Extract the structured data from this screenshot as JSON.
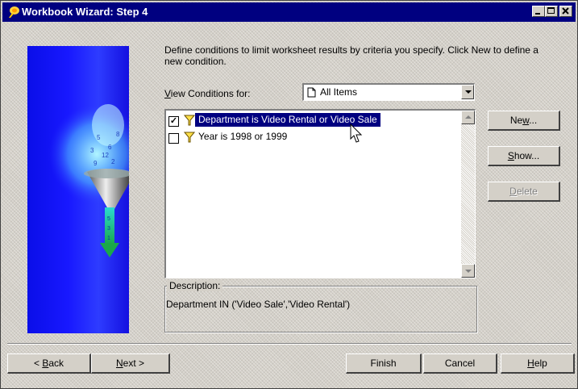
{
  "window": {
    "title": "Workbook Wizard: Step 4",
    "controls": {
      "minimize": "_",
      "maximize": "□",
      "close": "×"
    }
  },
  "intro_text": "Define conditions to limit worksheet results by criteria you specify. Click New to define a new condition.",
  "view_conditions": {
    "label": "View Conditions for:",
    "accel_char": "V",
    "label_rest": "iew Conditions for:",
    "selected": "All Items"
  },
  "conditions": [
    {
      "label": "Department is Video Rental or Video Sale",
      "checked": true,
      "selected": true
    },
    {
      "label": "Year is 1998 or 1999",
      "checked": false,
      "selected": false
    }
  ],
  "description": {
    "label": "Description:",
    "text": "Department IN ('Video Sale','Video Rental')"
  },
  "side_buttons": {
    "new": {
      "pre": "Ne",
      "accel": "w",
      "post": "...",
      "label": "New..."
    },
    "show": {
      "pre": "",
      "accel": "S",
      "post": "how...",
      "label": "Show..."
    },
    "delete": {
      "pre": "",
      "accel": "D",
      "post": "elete",
      "label": "Delete",
      "enabled": false
    }
  },
  "bottom_buttons": {
    "back": {
      "pre": "< ",
      "accel": "B",
      "post": "ack",
      "label": "< Back"
    },
    "next": {
      "pre": "",
      "accel": "N",
      "post": "ext >",
      "label": "Next >"
    },
    "finish": "Finish",
    "cancel": "Cancel",
    "help": {
      "pre": "",
      "accel": "H",
      "post": "elp",
      "label": "Help"
    }
  },
  "colors": {
    "titlebar": "#000080",
    "selection": "#000080",
    "dialog_bg": "#d4d0c8",
    "side_image_blue": "#1818ff"
  },
  "icons": {
    "title": "wizard-icon",
    "combo": "document-icon",
    "condition": "funnel-filter-icon"
  }
}
